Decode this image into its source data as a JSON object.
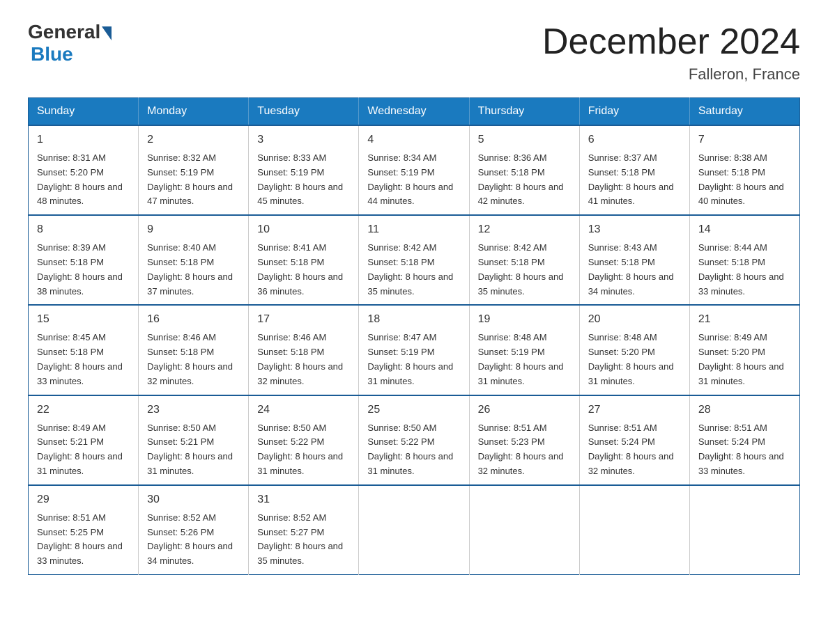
{
  "header": {
    "logo_general": "General",
    "logo_blue": "Blue",
    "title": "December 2024",
    "location": "Falleron, France"
  },
  "weekdays": [
    "Sunday",
    "Monday",
    "Tuesday",
    "Wednesday",
    "Thursday",
    "Friday",
    "Saturday"
  ],
  "weeks": [
    [
      {
        "day": "1",
        "sunrise": "8:31 AM",
        "sunset": "5:20 PM",
        "daylight": "8 hours and 48 minutes."
      },
      {
        "day": "2",
        "sunrise": "8:32 AM",
        "sunset": "5:19 PM",
        "daylight": "8 hours and 47 minutes."
      },
      {
        "day": "3",
        "sunrise": "8:33 AM",
        "sunset": "5:19 PM",
        "daylight": "8 hours and 45 minutes."
      },
      {
        "day": "4",
        "sunrise": "8:34 AM",
        "sunset": "5:19 PM",
        "daylight": "8 hours and 44 minutes."
      },
      {
        "day": "5",
        "sunrise": "8:36 AM",
        "sunset": "5:18 PM",
        "daylight": "8 hours and 42 minutes."
      },
      {
        "day": "6",
        "sunrise": "8:37 AM",
        "sunset": "5:18 PM",
        "daylight": "8 hours and 41 minutes."
      },
      {
        "day": "7",
        "sunrise": "8:38 AM",
        "sunset": "5:18 PM",
        "daylight": "8 hours and 40 minutes."
      }
    ],
    [
      {
        "day": "8",
        "sunrise": "8:39 AM",
        "sunset": "5:18 PM",
        "daylight": "8 hours and 38 minutes."
      },
      {
        "day": "9",
        "sunrise": "8:40 AM",
        "sunset": "5:18 PM",
        "daylight": "8 hours and 37 minutes."
      },
      {
        "day": "10",
        "sunrise": "8:41 AM",
        "sunset": "5:18 PM",
        "daylight": "8 hours and 36 minutes."
      },
      {
        "day": "11",
        "sunrise": "8:42 AM",
        "sunset": "5:18 PM",
        "daylight": "8 hours and 35 minutes."
      },
      {
        "day": "12",
        "sunrise": "8:42 AM",
        "sunset": "5:18 PM",
        "daylight": "8 hours and 35 minutes."
      },
      {
        "day": "13",
        "sunrise": "8:43 AM",
        "sunset": "5:18 PM",
        "daylight": "8 hours and 34 minutes."
      },
      {
        "day": "14",
        "sunrise": "8:44 AM",
        "sunset": "5:18 PM",
        "daylight": "8 hours and 33 minutes."
      }
    ],
    [
      {
        "day": "15",
        "sunrise": "8:45 AM",
        "sunset": "5:18 PM",
        "daylight": "8 hours and 33 minutes."
      },
      {
        "day": "16",
        "sunrise": "8:46 AM",
        "sunset": "5:18 PM",
        "daylight": "8 hours and 32 minutes."
      },
      {
        "day": "17",
        "sunrise": "8:46 AM",
        "sunset": "5:18 PM",
        "daylight": "8 hours and 32 minutes."
      },
      {
        "day": "18",
        "sunrise": "8:47 AM",
        "sunset": "5:19 PM",
        "daylight": "8 hours and 31 minutes."
      },
      {
        "day": "19",
        "sunrise": "8:48 AM",
        "sunset": "5:19 PM",
        "daylight": "8 hours and 31 minutes."
      },
      {
        "day": "20",
        "sunrise": "8:48 AM",
        "sunset": "5:20 PM",
        "daylight": "8 hours and 31 minutes."
      },
      {
        "day": "21",
        "sunrise": "8:49 AM",
        "sunset": "5:20 PM",
        "daylight": "8 hours and 31 minutes."
      }
    ],
    [
      {
        "day": "22",
        "sunrise": "8:49 AM",
        "sunset": "5:21 PM",
        "daylight": "8 hours and 31 minutes."
      },
      {
        "day": "23",
        "sunrise": "8:50 AM",
        "sunset": "5:21 PM",
        "daylight": "8 hours and 31 minutes."
      },
      {
        "day": "24",
        "sunrise": "8:50 AM",
        "sunset": "5:22 PM",
        "daylight": "8 hours and 31 minutes."
      },
      {
        "day": "25",
        "sunrise": "8:50 AM",
        "sunset": "5:22 PM",
        "daylight": "8 hours and 31 minutes."
      },
      {
        "day": "26",
        "sunrise": "8:51 AM",
        "sunset": "5:23 PM",
        "daylight": "8 hours and 32 minutes."
      },
      {
        "day": "27",
        "sunrise": "8:51 AM",
        "sunset": "5:24 PM",
        "daylight": "8 hours and 32 minutes."
      },
      {
        "day": "28",
        "sunrise": "8:51 AM",
        "sunset": "5:24 PM",
        "daylight": "8 hours and 33 minutes."
      }
    ],
    [
      {
        "day": "29",
        "sunrise": "8:51 AM",
        "sunset": "5:25 PM",
        "daylight": "8 hours and 33 minutes."
      },
      {
        "day": "30",
        "sunrise": "8:52 AM",
        "sunset": "5:26 PM",
        "daylight": "8 hours and 34 minutes."
      },
      {
        "day": "31",
        "sunrise": "8:52 AM",
        "sunset": "5:27 PM",
        "daylight": "8 hours and 35 minutes."
      },
      null,
      null,
      null,
      null
    ]
  ]
}
